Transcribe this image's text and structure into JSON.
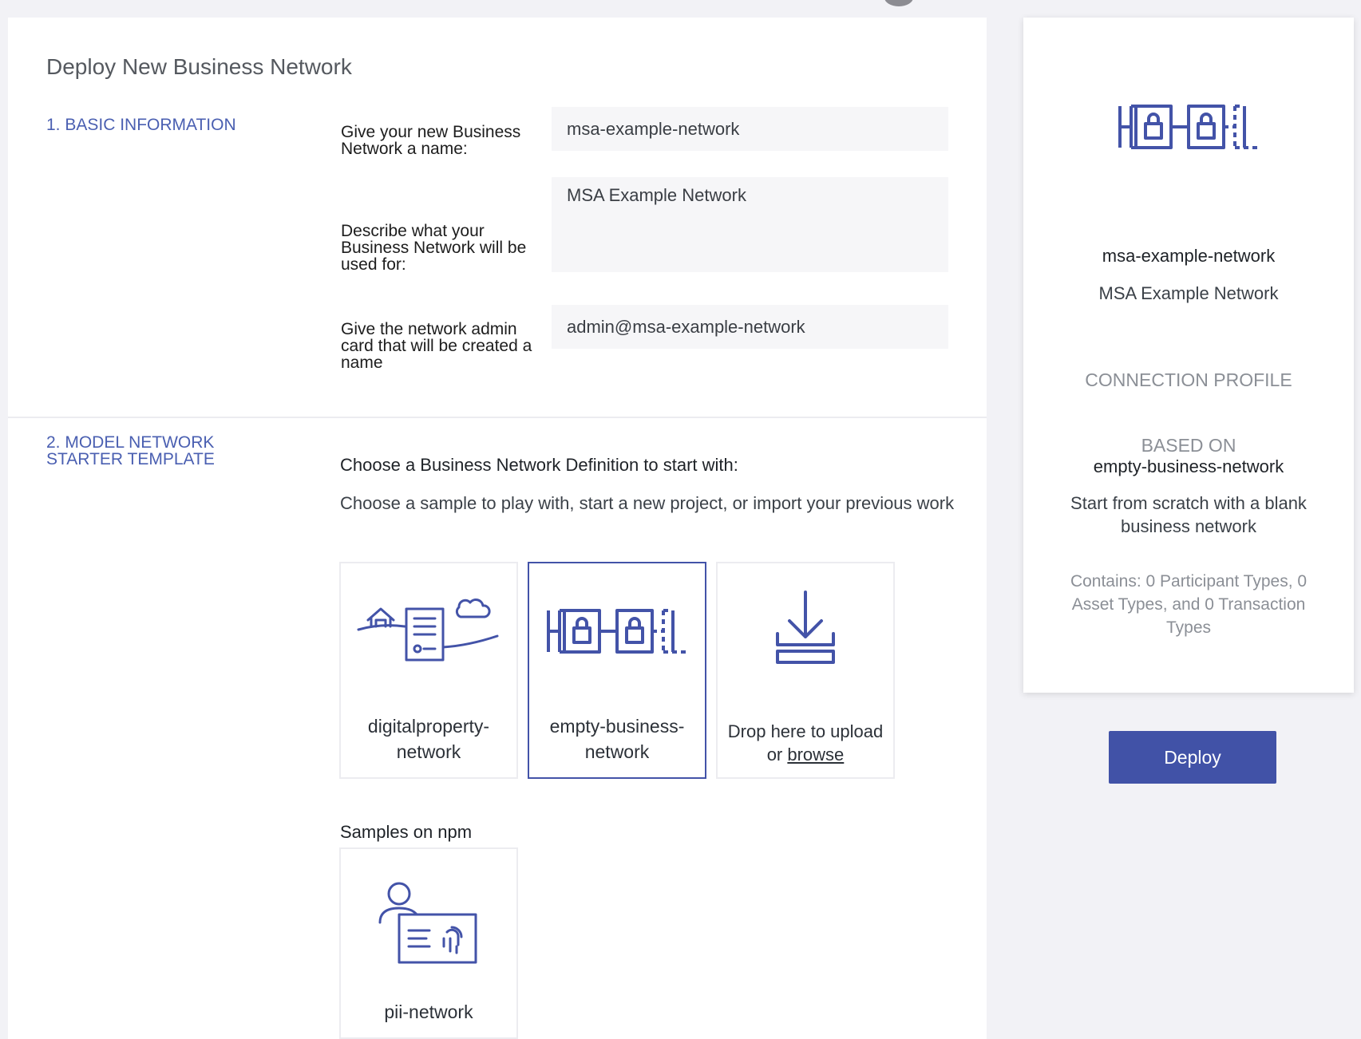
{
  "page_title": "Deploy New Business Network",
  "basic_info": {
    "section_label": "1. BASIC INFORMATION",
    "name_label": "Give your new Business Network a name:",
    "name_value": "msa-example-network",
    "description_label": "Describe what your Business Network will be used for:",
    "description_value": "MSA Example Network",
    "admin_card_label": "Give the network admin card that will be created a name",
    "admin_card_value": "admin@msa-example-network"
  },
  "template": {
    "section_label": "2. MODEL NETWORK STARTER TEMPLATE",
    "choose_title": "Choose a Business Network Definition to start with:",
    "choose_subtitle": "Choose a sample to play with, start a new project, or import your previous work",
    "tiles": [
      {
        "label": "digitalproperty-network",
        "icon": "digital-property-icon",
        "selected": false
      },
      {
        "label": "empty-business-network",
        "icon": "business-network-chain-icon",
        "selected": true
      },
      {
        "label_prefix": "Drop here to upload or",
        "link": "browse",
        "icon": "upload-icon",
        "selected": false
      }
    ],
    "npm_title": "Samples on npm",
    "npm_tiles": [
      {
        "label": "pii-network",
        "icon": "identity-fingerprint-icon"
      }
    ]
  },
  "summary": {
    "network_name": "msa-example-network",
    "network_description": "MSA Example Network",
    "connection_profile_label": "CONNECTION PROFILE",
    "based_on_label": "BASED ON",
    "based_on_name": "empty-business-network",
    "based_on_description": "Start from scratch with a blank business network",
    "contains": "Contains: 0 Participant Types, 0 Asset Types, and 0 Transaction Types"
  },
  "deploy_label": "Deploy",
  "colors": {
    "accent": "#4353a8",
    "section_label": "#4a5fb1",
    "input_bg": "#f6f6f8",
    "page_bg": "#f2f2f6"
  }
}
